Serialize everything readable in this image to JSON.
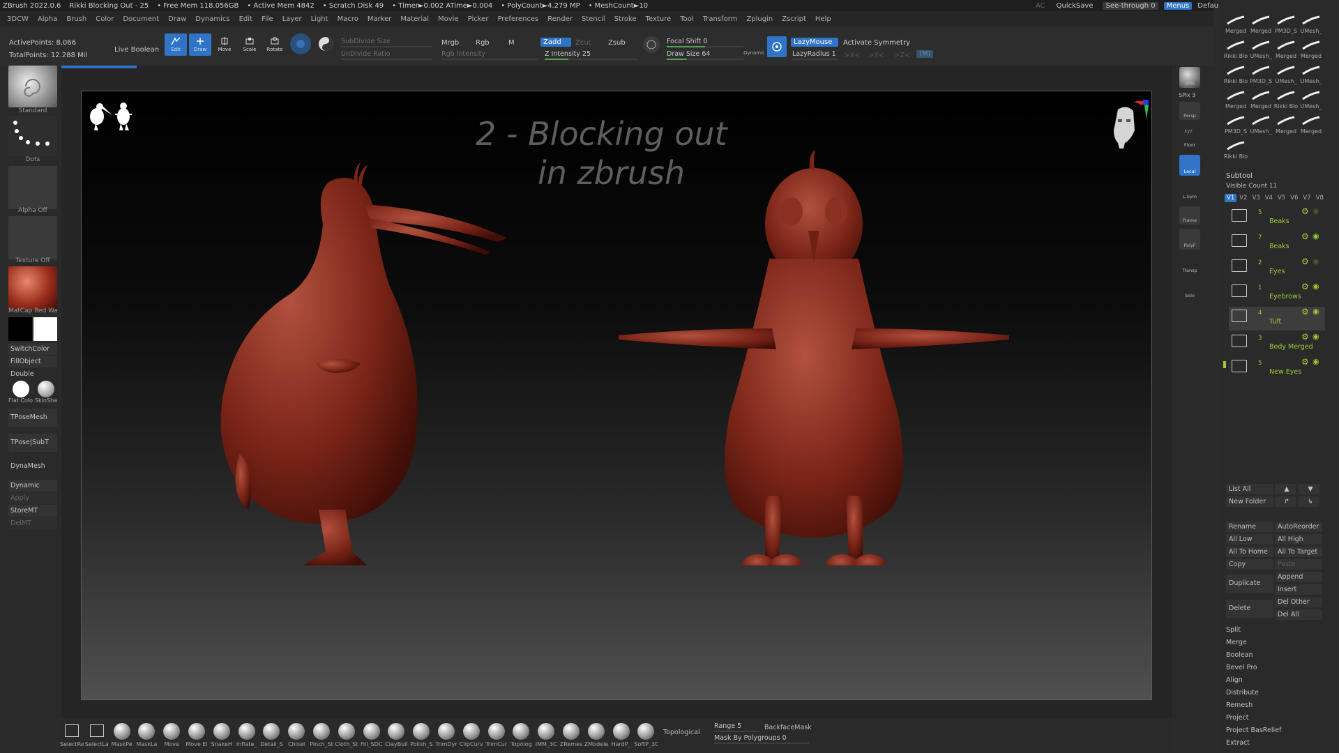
{
  "titlebar": {
    "app": "ZBrush 2022.0.6",
    "doc": "Rikki Blocking Out - 25",
    "stats": [
      "• Free Mem 118.056GB",
      "• Active Mem 4842",
      "• Scratch Disk 49",
      "• Timer►0.002 ATime►0.004",
      "• PolyCount►4.279 MP",
      "• MeshCount►10"
    ],
    "ac": "AC",
    "quicksave": "QuickSave",
    "seethrough": "See-through  0",
    "menus": "Menus",
    "script": "DefaultZScript"
  },
  "menubar": [
    "3DCW",
    "Alpha",
    "Brush",
    "Color",
    "Document",
    "Draw",
    "Dynamics",
    "Edit",
    "File",
    "Layer",
    "Light",
    "Macro",
    "Marker",
    "Material",
    "Movie",
    "Picker",
    "Preferences",
    "Render",
    "Stencil",
    "Stroke",
    "Texture",
    "Tool",
    "Transform",
    "Zplugin",
    "Zscript",
    "Help"
  ],
  "toolbar": {
    "active_points": "ActivePoints: 8,066",
    "total_points": "TotalPoints: 12.288 Mil",
    "live_boolean": "Live Boolean",
    "edit": "Edit",
    "draw": "Draw",
    "move": "Move",
    "scale": "Scale",
    "rotate": "Rotate",
    "subdivide_size": "SubDivide Size",
    "undivide_ratio": "UnDivide Ratio",
    "mrgb": "Mrgb",
    "rgb": "Rgb",
    "m": "M",
    "rgb_intensity": "Rgb Intensity",
    "zadd": "Zadd",
    "zcut": "Zcut",
    "zsub": "Zsub",
    "z_intensity": "Z Intensity 25",
    "focal_shift": "Focal Shift 0",
    "draw_size": "Draw Size 64",
    "dynamic": "Dynamic",
    "lazymouse": "LazyMouse",
    "lazyradius": "LazyRadius 1",
    "activate_symmetry": "Activate Symmetry",
    "sym_x": ">X<",
    "sym_y": ">Y<",
    "sym_z": ">Z<",
    "sym_m": "(M)",
    "z_intensity_value": 25,
    "focal_shift_value": 0,
    "draw_size_value": 64
  },
  "leftshelf": {
    "standard": "Standard",
    "dots": "Dots",
    "alpha": "Alpha Off",
    "texture": "Texture Off",
    "material": "MatCap Red Wax",
    "switch_color": "SwitchColor",
    "fill_object": "FillObject",
    "double": "Double",
    "flat_color": "Flat Colo",
    "skin_shade": "SkinSha",
    "tpose_mesh": "TPoseMesh",
    "tpose_subt": "TPose|SubT",
    "dynamesh": "DynaMesh",
    "dynamic": "Dynamic",
    "apply": "Apply",
    "store_mt": "StoreMT",
    "del_mt": "DelMT"
  },
  "canvas": {
    "line1": "2 - Blocking out",
    "line2": "in zbrush"
  },
  "rightshelf": {
    "bpr": "BPR",
    "spix": "SPix 3",
    "persp": "Persp",
    "xyz": "xyz",
    "floor": "Floor",
    "local": "Local",
    "lsym": "L.Sym",
    "frame": "Frame",
    "polyf": "PolyF",
    "transp": "Transp",
    "solo": "Solo"
  },
  "brushes": [
    {
      "label": "Merged"
    },
    {
      "label": "Merged"
    },
    {
      "label": "PM3D_S"
    },
    {
      "label": "UMesh_"
    },
    {
      "label": "Rikki Blo"
    },
    {
      "label": "UMesh_"
    },
    {
      "label": "Merged"
    },
    {
      "label": "Merged"
    },
    {
      "label": "Rikki Blo"
    },
    {
      "label": "PM3D_S"
    },
    {
      "label": "UMesh_"
    },
    {
      "label": "UMesh_"
    },
    {
      "label": "Merged"
    },
    {
      "label": "Merged"
    },
    {
      "label": "Rikki Blo"
    },
    {
      "label": "UMesh_"
    },
    {
      "label": "PM3D_S"
    },
    {
      "label": "UMesh_"
    },
    {
      "label": "Merged"
    },
    {
      "label": "Merged"
    },
    {
      "label": "Rikki Blo"
    }
  ],
  "subtool": {
    "title": "Subtool",
    "visible_count": "Visible Count 11",
    "versions": [
      "V1",
      "V2",
      "V3",
      "V4",
      "V5",
      "V6",
      "V7",
      "V8"
    ],
    "items": [
      {
        "count": "5",
        "name": "Beaks"
      },
      {
        "count": "7",
        "name": "Beaks"
      },
      {
        "count": "2",
        "name": "Eyes"
      },
      {
        "count": "1",
        "name": "Eyebrows"
      },
      {
        "count": "4",
        "name": "Tuft"
      },
      {
        "count": "3",
        "name": "Body Merged"
      },
      {
        "count": "5",
        "name": "New Eyes"
      }
    ],
    "list_all": "List All",
    "new_folder": "New Folder",
    "rename": "Rename",
    "auto_reorder": "AutoReorder",
    "all_low": "All Low",
    "all_high": "All High",
    "all_to_home": "All To Home",
    "all_to_target": "All To Target",
    "copy": "Copy",
    "paste": "Paste",
    "duplicate": "Duplicate",
    "append": "Append",
    "insert": "Insert",
    "delete": "Delete",
    "del_other": "Del Other",
    "del_all": "Del All",
    "actions": [
      "Split",
      "Merge",
      "Boolean",
      "Bevel Pro",
      "Align",
      "Distribute",
      "Remesh",
      "Project",
      "Project BasRelief",
      "Extract"
    ]
  },
  "bottombar": {
    "brushes": [
      "SelectRe",
      "SelectLa",
      "MaskPe",
      "MaskLa",
      "Move",
      "Move El",
      "SnakeH",
      "Inflate_",
      "Detail_S",
      "Chisel",
      "Pinch_St",
      "Cloth_St",
      "Fill_SDC",
      "ClayBuil",
      "Polish_S",
      "TrimDyr",
      "ClipCurv",
      "TrimCur",
      "Topolog",
      "IMM_3C",
      "ZRemes",
      "ZModele",
      "HardP_",
      "SoftP_3C"
    ],
    "topological": "Topological",
    "range": "Range 5",
    "backface_mask": "BackfaceMask",
    "mask_by_polygroups": "Mask By Polygroups 0"
  }
}
